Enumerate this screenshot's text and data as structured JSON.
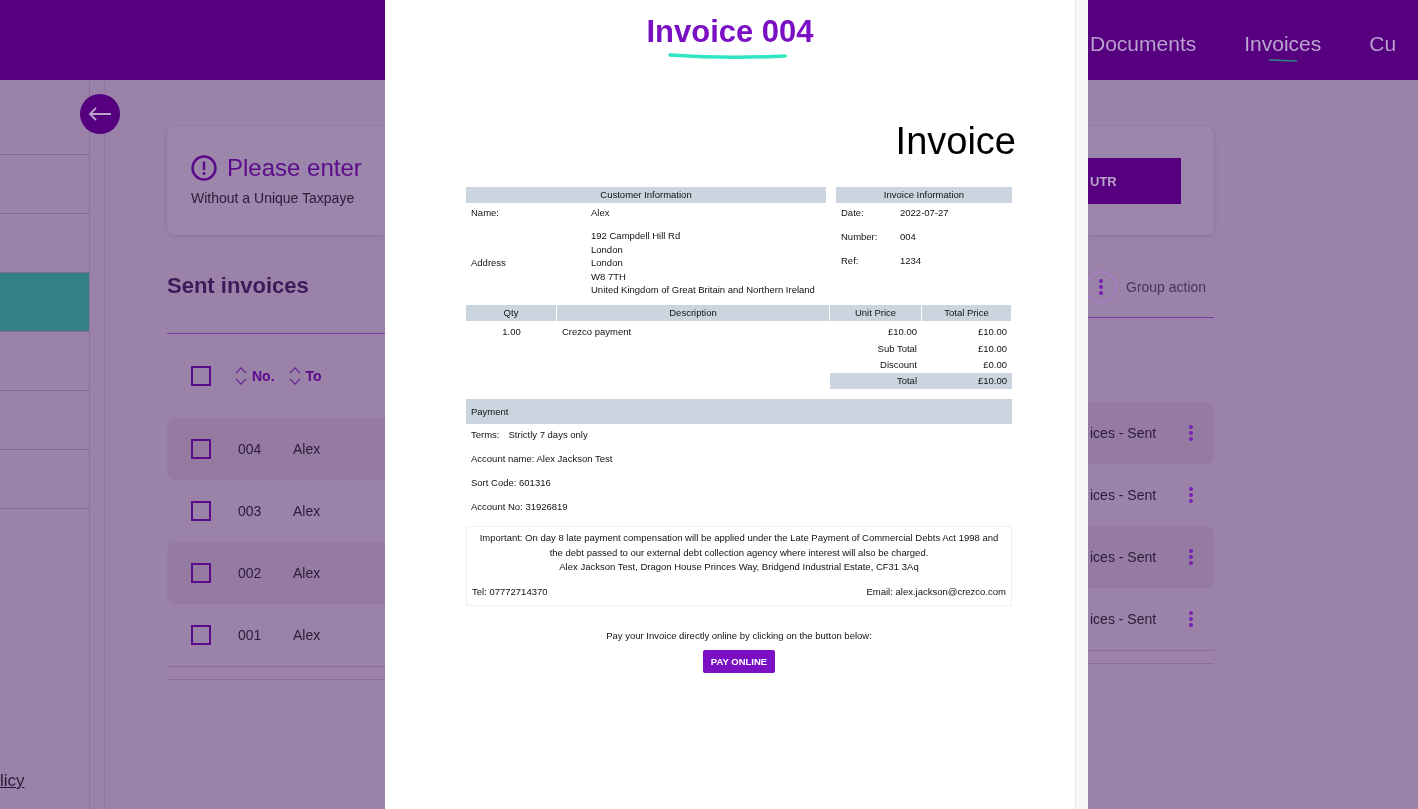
{
  "header": {
    "nav": [
      {
        "label": "Documents",
        "selected": false
      },
      {
        "label": "Invoices",
        "selected": true
      },
      {
        "label": "Cu",
        "selected": false
      }
    ]
  },
  "sidebar": {
    "items": [
      {
        "selected": false
      },
      {
        "selected": false
      },
      {
        "selected": true
      },
      {
        "selected": false
      },
      {
        "selected": false
      },
      {
        "selected": false
      }
    ],
    "footer_link": "licy"
  },
  "utr_alert": {
    "title": "Please enter",
    "text": "Without a Unique Taxpaye",
    "button": "UTR"
  },
  "sent_invoices": {
    "title": "Sent invoices",
    "group_action": "Group action",
    "select_all_checked": false,
    "columns": [
      "No.",
      "To"
    ],
    "rows": [
      {
        "number": "004",
        "to": "Alex",
        "status": "ices - Sent",
        "checked": false
      },
      {
        "number": "003",
        "to": "Alex",
        "status": "ices - Sent",
        "checked": false
      },
      {
        "number": "002",
        "to": "Alex",
        "status": "ices - Sent",
        "checked": false
      },
      {
        "number": "001",
        "to": "Alex",
        "status": "ices - Sent",
        "checked": false
      }
    ]
  },
  "modal": {
    "title": "Invoice 004",
    "document": {
      "heading": "Invoice",
      "customer": {
        "header": "Customer Information",
        "fields": [
          {
            "label": "Name:",
            "lines": [
              "Alex"
            ]
          },
          {
            "label": "Address",
            "lines": [
              "192 Campdell Hill Rd",
              "London",
              "London",
              "W8 7TH",
              "United Kingdom of Great Britain and Northern Ireland"
            ]
          }
        ]
      },
      "invoice_info": {
        "header": "Invoice Information",
        "fields": [
          {
            "label": "Date:",
            "value": "2022-07-27"
          },
          {
            "label": "Number:",
            "value": "004"
          },
          {
            "label": "Ref:",
            "value": "1234"
          }
        ]
      },
      "items": {
        "columns": [
          "Qty",
          "Description",
          "Unit Price",
          "Total Price"
        ],
        "rows": [
          {
            "qty": "1.00",
            "description": "Crezco payment",
            "unit_price": "£10.00",
            "total": "£10.00"
          }
        ],
        "totals": [
          {
            "label": "Sub Total",
            "value": "£10.00",
            "highlight": false
          },
          {
            "label": "Discount",
            "value": "£0.00",
            "highlight": false
          },
          {
            "label": "Total",
            "value": "£10.00",
            "highlight": true
          }
        ]
      },
      "payment": {
        "header": "Payment",
        "terms_label": "Terms:",
        "terms": "Strictly 7 days only",
        "lines": [
          "Account name: Alex Jackson Test",
          "Sort Code: 601316",
          "Account No: 31926819"
        ]
      },
      "notice": {
        "text": "Important: On day 8 late payment compensation will be applied under the Late Payment of Commercial Debts Act 1998 and the debt passed to our external debt collection agency where interest will also be charged.",
        "address": "Alex Jackson Test, Dragon House Princes Way, Bridgend Industrial Estate, CF31 3Aq",
        "tel": "Tel: 07772714370",
        "email": "Email: alex.jackson@crezco.com"
      },
      "pay_prompt": "Pay your Invoice directly online by clicking on the button below:",
      "pay_button": "PAY ONLINE"
    }
  }
}
